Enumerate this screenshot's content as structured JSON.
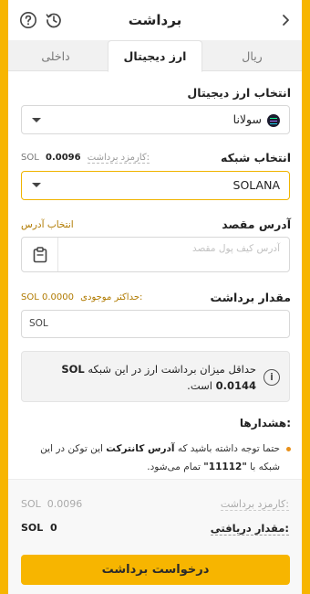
{
  "header": {
    "title": "برداشت"
  },
  "tabs": {
    "rial": "ریال",
    "digital": "ارز دیجیتال",
    "internal": "داخلی"
  },
  "currency": {
    "label": "انتخاب ارز دیجیتال",
    "value": "سولانا",
    "icon": "solana-icon"
  },
  "network": {
    "label": "انتخاب شبکه",
    "fee_label": "کارمزد برداشت:",
    "fee_value": "0.0096",
    "fee_unit": "SOL",
    "value": "SOLANA"
  },
  "address": {
    "label": "آدرس مقصد",
    "select_link": "انتخاب آدرس",
    "placeholder": "آدرس کیف پول مقصد"
  },
  "amount": {
    "label": "مقدار برداشت",
    "max_label": "حداکثر موجودی:",
    "max_value": "0.0000",
    "max_unit": "SOL",
    "unit": "SOL"
  },
  "info": {
    "text_before": "حداقل میزان برداشت ارز در این شبکه",
    "min_value": "0.0144",
    "min_unit": "SOL",
    "text_after": "است."
  },
  "warnings": {
    "title": "هشدارها:",
    "item_pre": "حتما توجه داشته باشید که",
    "item_bold": "آدرس کانترکت",
    "item_mid": "این توکن در این شبکه با",
    "item_code": "\"11112\"",
    "item_post": "تمام می‌شود."
  },
  "footer": {
    "fee_label": "کارمزد برداشت:",
    "fee_value": "0.0096",
    "fee_unit": "SOL",
    "receive_label": "مقدار دریافتی:",
    "receive_value": "0",
    "receive_unit": "SOL",
    "submit_label": "درخواست برداشت"
  },
  "colors": {
    "accent": "#f7b500",
    "link": "#b07a00",
    "warning_bullet": "#e8901a"
  }
}
